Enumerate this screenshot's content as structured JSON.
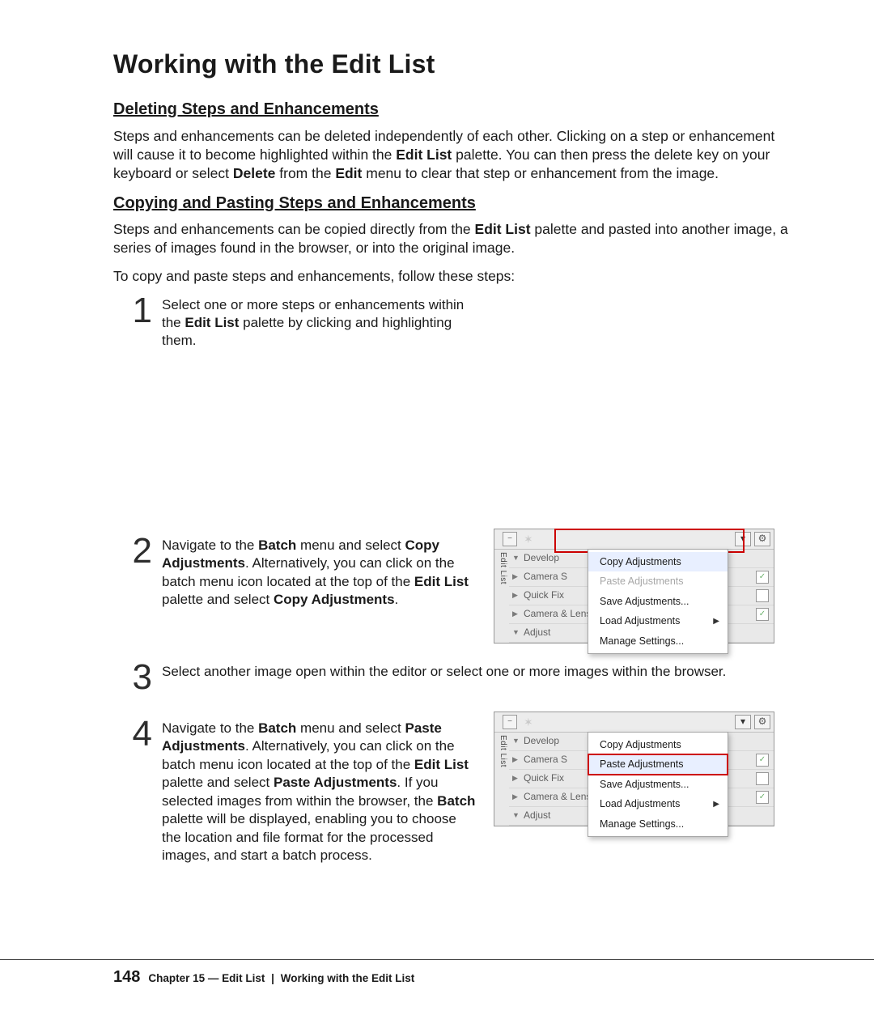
{
  "title": "Working with the Edit List",
  "section1": {
    "heading": "Deleting Steps and Enhancements",
    "para_parts": [
      "Steps and enhancements can be deleted independently of each other. Clicking on a step or enhancement will cause it to become highlighted within the ",
      "Edit List",
      " palette. You can then press the delete key on your keyboard or select ",
      "Delete",
      " from the ",
      "Edit",
      " menu to clear that step or enhancement from the image."
    ]
  },
  "section2": {
    "heading": "Copying and Pasting Steps and Enhancements",
    "para1_parts": [
      "Steps and enhancements can be copied directly from the ",
      "Edit List",
      " palette and pasted into another image, a series of images found in the browser, or into the original image."
    ],
    "para2": "To copy and paste steps and enhancements, follow these steps:"
  },
  "steps": {
    "s1": {
      "num": "1",
      "text_parts": [
        "Select one or more steps or enhancements within the ",
        "Edit List",
        " palette by clicking and highlighting them."
      ]
    },
    "s2": {
      "num": "2",
      "text_parts": [
        "Navigate to the ",
        "Batch",
        " menu and select ",
        "Copy Adjustments",
        ". Alternatively, you can click on the batch menu icon located at the top of the ",
        "Edit List",
        " palette and select ",
        "Copy Adjustments",
        "."
      ]
    },
    "s3": {
      "num": "3",
      "text": "Select another image open within the editor or select one or more images within the browser."
    },
    "s4": {
      "num": "4",
      "text_parts": [
        "Navigate to the ",
        "Batch",
        " menu and select ",
        "Paste Adjustments",
        ". Alternatively, you can click on the batch menu icon located at the top of the ",
        "Edit List",
        " palette and select ",
        "Paste Adjustments",
        ". If you selected images from within the browser, the ",
        "Batch",
        " palette will be displayed, enabling you to choose the location and file format for the processed images, and start a batch process."
      ]
    }
  },
  "palette": {
    "side_label": "Edit List",
    "tree": {
      "develop": "Develop",
      "camera": "Camera S",
      "quickfix": "Quick Fix",
      "lens": "Camera & Lens Corrections",
      "adjust": "Adjust"
    },
    "menu": {
      "copy": "Copy Adjustments",
      "paste": "Paste Adjustments",
      "save": "Save Adjustments...",
      "load": "Load Adjustments",
      "manage": "Manage Settings..."
    }
  },
  "footer": {
    "page": "148",
    "chapter": "Chapter 15 — Edit List",
    "subsection": "Working with the Edit List"
  }
}
